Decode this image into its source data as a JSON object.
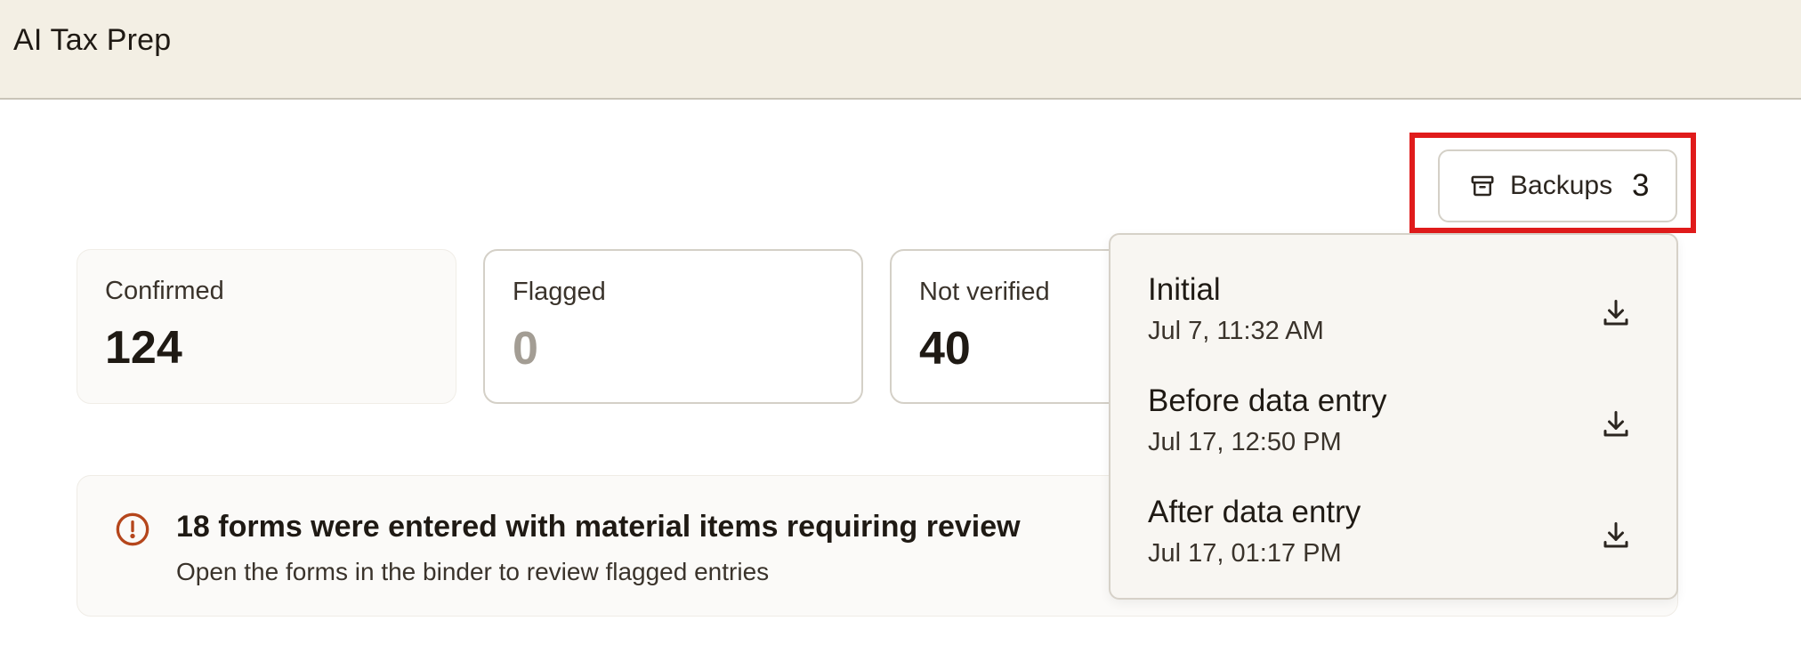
{
  "header": {
    "title": "AI Tax Prep"
  },
  "backups_button": {
    "label": "Backups",
    "count": "3",
    "icon": "archive-box-icon"
  },
  "stats": {
    "confirmed": {
      "label": "Confirmed",
      "value": "124"
    },
    "flagged": {
      "label": "Flagged",
      "value": "0"
    },
    "not_verified": {
      "label": "Not verified",
      "value": "40"
    }
  },
  "alert": {
    "icon": "alert-circle-icon",
    "title": "18 forms were entered with material items requiring review",
    "subtitle": "Open the forms in the binder to review flagged entries"
  },
  "backups_menu": {
    "items": [
      {
        "name": "Initial",
        "date": "Jul 7, 11:32 AM",
        "icon": "download-icon"
      },
      {
        "name": "Before data entry",
        "date": "Jul 17, 12:50 PM",
        "icon": "download-icon"
      },
      {
        "name": "After data entry",
        "date": "Jul 17, 01:17 PM",
        "icon": "download-icon"
      }
    ]
  },
  "colors": {
    "header_bg": "#f3efe4",
    "highlight": "#e01b1b",
    "alert_icon": "#b5461c",
    "muted_value": "#a39d94"
  }
}
